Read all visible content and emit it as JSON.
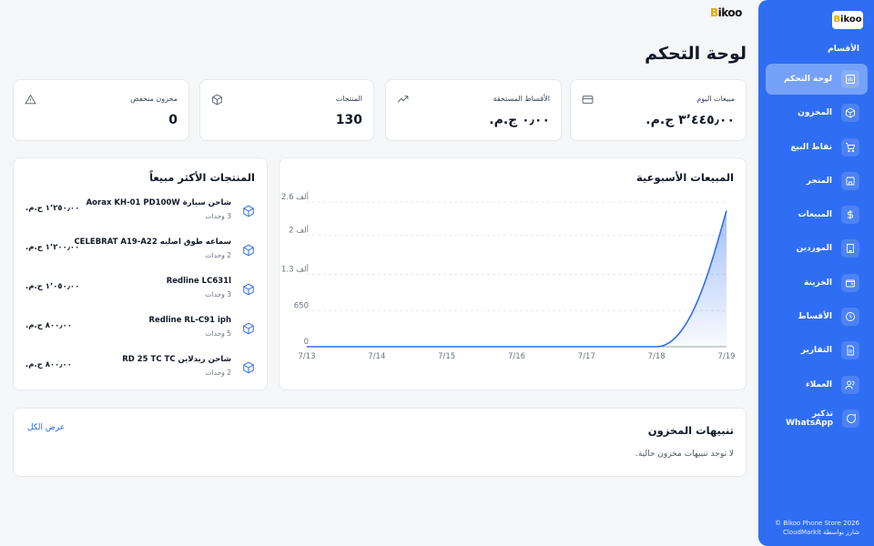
{
  "sidebar": {
    "logo": "Bikoo",
    "section_label": "الأقسام",
    "items": [
      {
        "label": "لوحة التحكم",
        "icon": "bar-chart-icon",
        "active": true
      },
      {
        "label": "المخزون",
        "icon": "box-icon"
      },
      {
        "label": "نقاط البيع",
        "icon": "cart-icon"
      },
      {
        "label": "المتجر",
        "icon": "store-icon"
      },
      {
        "label": "المبيعات",
        "icon": "dollar-icon"
      },
      {
        "label": "الموردين",
        "icon": "building-icon"
      },
      {
        "label": "الخزينة",
        "icon": "wallet-icon"
      },
      {
        "label": "الأقساط",
        "icon": "clock-icon"
      },
      {
        "label": "التقارير",
        "icon": "document-icon"
      },
      {
        "label": "العملاء",
        "icon": "users-icon"
      },
      {
        "label": "تذكير WhatsApp",
        "icon": "chat-icon"
      }
    ],
    "footer_line1": "© Bikoo Phone Store 2026",
    "footer_line2": "شارز بواسطة CloudMarkit"
  },
  "header": {
    "brand": "Bikoo",
    "title": "لوحة التحكم"
  },
  "stats": [
    {
      "label": "مبيعات اليوم",
      "value": "٣٬٤٤٥٫٠٠ ج.م.",
      "icon": "credit-card-icon"
    },
    {
      "label": "الأقساط المستحقة",
      "value": "٠٫٠٠ ج.م.",
      "icon": "trending-up-icon"
    },
    {
      "label": "المنتجات",
      "value": "130",
      "icon": "box-icon"
    },
    {
      "label": "مخزون منخفض",
      "value": "0",
      "icon": "warning-icon"
    }
  ],
  "top_products": {
    "title": "المنتجات الأكثر مبيعاً",
    "items": [
      {
        "name": "شاحن سيارة Aorax KH-01 PD100W",
        "qty": "3 وحدات",
        "price": "١٬٢٥٠٫٠٠ ج.م."
      },
      {
        "name": "سماعه طوق اصليه CELEBRAT A19-A22",
        "qty": "2 وحدات",
        "price": "١٬٢٠٠٫٠٠ ج.م."
      },
      {
        "name": "Redline LC631l",
        "qty": "3 وحدات",
        "price": "١٬٠٥٠٫٠٠ ج.م."
      },
      {
        "name": "Redline RL-C91 iph",
        "qty": "5 وحدات",
        "price": "٨٠٠٫٠٠ ج.م."
      },
      {
        "name": "شاحن ريدلاين RD 25 TC TC",
        "qty": "2 وحدات",
        "price": "٨٠٠٫٠٠ ج.م."
      }
    ]
  },
  "chart_data": {
    "type": "area",
    "title": "المبيعات الأسبوعية",
    "categories": [
      "7/13",
      "7/14",
      "7/15",
      "7/16",
      "7/17",
      "7/18",
      "7/19"
    ],
    "values": [
      0,
      0,
      0,
      0,
      0,
      0,
      2445
    ],
    "y_ticks": [
      0,
      650,
      1300,
      2000,
      2600
    ],
    "y_tick_labels": [
      "0",
      "650",
      "1.3 ألف",
      "2 ألف",
      "2.6 ألف"
    ],
    "ylim": [
      0,
      2600
    ],
    "grid": "horizontal-dashed",
    "color": "#2f6ef3"
  },
  "alerts": {
    "title": "تنبيهات المخزون",
    "view_all": "عرض الكل",
    "empty": "لا توجد تنبيهات مخزون حالية."
  }
}
